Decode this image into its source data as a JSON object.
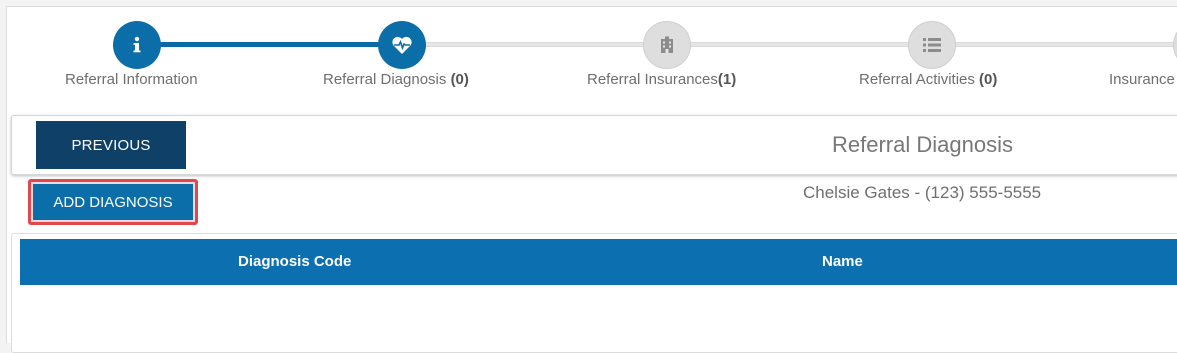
{
  "stepper": {
    "steps": [
      {
        "label": "Referral Information",
        "count": "",
        "icon": "info-icon",
        "state": "active"
      },
      {
        "label": "Referral Diagnosis ",
        "count": "(0)",
        "icon": "heart-pulse-icon",
        "state": "active"
      },
      {
        "label": "Referral Insurances",
        "count": "(1)",
        "icon": "building-icon",
        "state": "inactive"
      },
      {
        "label": "Referral Activities ",
        "count": "(0)",
        "icon": "list-icon",
        "state": "inactive"
      },
      {
        "label": "Insurance",
        "count": "",
        "icon": "circle-icon",
        "state": "inactive"
      }
    ]
  },
  "header": {
    "previous_label": "PREVIOUS",
    "title": "Referral Diagnosis"
  },
  "actions": {
    "add_diagnosis_label": "ADD DIAGNOSIS"
  },
  "patient": {
    "summary": "Chelsie Gates - (123) 555-5555"
  },
  "table": {
    "columns": [
      "Diagnosis Code",
      "Name"
    ],
    "rows": []
  },
  "colors": {
    "primary": "#0b6ea9",
    "dark_button": "#0f4068",
    "highlight": "#e0484f",
    "inactive_step": "#dedede"
  }
}
